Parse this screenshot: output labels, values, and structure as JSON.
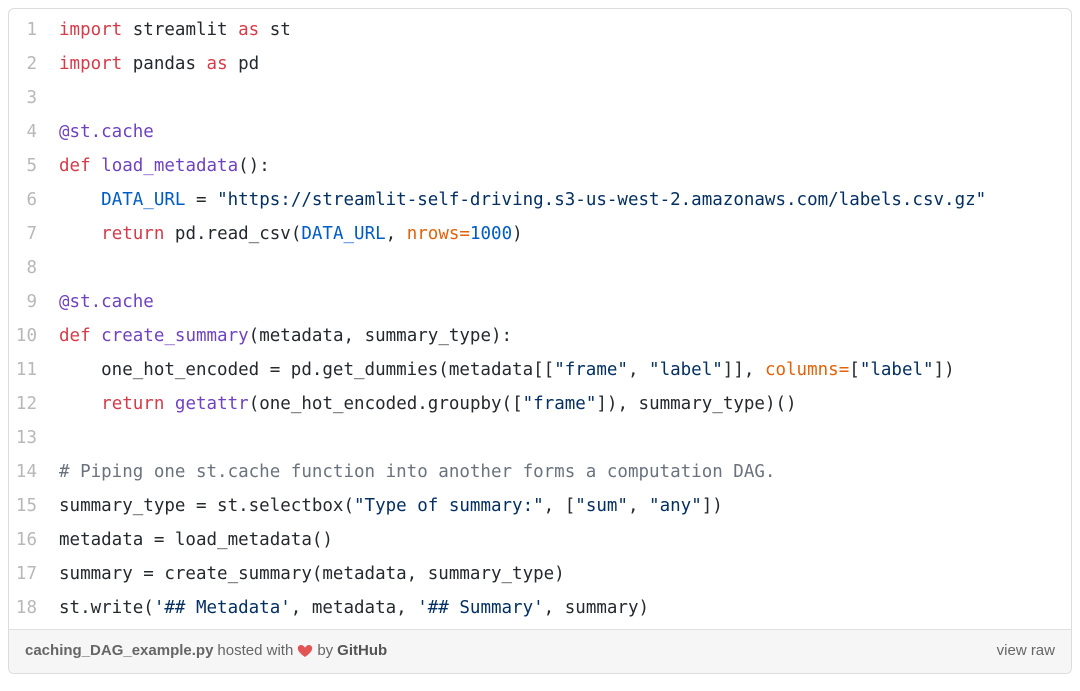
{
  "footer": {
    "filename": "caching_DAG_example.py",
    "hosted_prefix": " hosted with ",
    "by": " by ",
    "github": "GitHub",
    "view_raw": "view raw"
  },
  "lines": [
    {
      "n": "1",
      "tokens": [
        {
          "t": "import ",
          "c": "kw"
        },
        {
          "t": "streamlit ",
          "c": ""
        },
        {
          "t": "as ",
          "c": "kw"
        },
        {
          "t": "st",
          "c": ""
        }
      ]
    },
    {
      "n": "2",
      "tokens": [
        {
          "t": "import ",
          "c": "kw"
        },
        {
          "t": "pandas ",
          "c": ""
        },
        {
          "t": "as ",
          "c": "kw"
        },
        {
          "t": "pd",
          "c": ""
        }
      ]
    },
    {
      "n": "3",
      "tokens": [
        {
          "t": "",
          "c": ""
        }
      ]
    },
    {
      "n": "4",
      "tokens": [
        {
          "t": "@st.cache",
          "c": "dec"
        }
      ]
    },
    {
      "n": "5",
      "tokens": [
        {
          "t": "def ",
          "c": "kw"
        },
        {
          "t": "load_metadata",
          "c": "fn"
        },
        {
          "t": "():",
          "c": ""
        }
      ]
    },
    {
      "n": "6",
      "tokens": [
        {
          "t": "    ",
          "c": ""
        },
        {
          "t": "DATA_URL",
          "c": "const"
        },
        {
          "t": " = ",
          "c": ""
        },
        {
          "t": "\"https://streamlit-self-driving.s3-us-west-2.amazonaws.com/labels.csv.gz\"",
          "c": "str"
        }
      ]
    },
    {
      "n": "7",
      "tokens": [
        {
          "t": "    ",
          "c": ""
        },
        {
          "t": "return ",
          "c": "kw"
        },
        {
          "t": "pd.read_csv(",
          "c": ""
        },
        {
          "t": "DATA_URL",
          "c": "const"
        },
        {
          "t": ", ",
          "c": ""
        },
        {
          "t": "nrows",
          "c": "argn"
        },
        {
          "t": "=",
          "c": "argn"
        },
        {
          "t": "1000",
          "c": "const"
        },
        {
          "t": ")",
          "c": ""
        }
      ]
    },
    {
      "n": "8",
      "tokens": [
        {
          "t": "",
          "c": ""
        }
      ]
    },
    {
      "n": "9",
      "tokens": [
        {
          "t": "@st.cache",
          "c": "dec"
        }
      ]
    },
    {
      "n": "10",
      "tokens": [
        {
          "t": "def ",
          "c": "kw"
        },
        {
          "t": "create_summary",
          "c": "fn"
        },
        {
          "t": "(metadata, summary_type):",
          "c": ""
        }
      ]
    },
    {
      "n": "11",
      "tokens": [
        {
          "t": "    one_hot_encoded = pd.get_dummies(metadata[[",
          "c": ""
        },
        {
          "t": "\"frame\"",
          "c": "str"
        },
        {
          "t": ", ",
          "c": ""
        },
        {
          "t": "\"label\"",
          "c": "str"
        },
        {
          "t": "]], ",
          "c": ""
        },
        {
          "t": "columns",
          "c": "argn"
        },
        {
          "t": "=",
          "c": "argn"
        },
        {
          "t": "[",
          "c": ""
        },
        {
          "t": "\"label\"",
          "c": "str"
        },
        {
          "t": "])",
          "c": ""
        }
      ]
    },
    {
      "n": "12",
      "tokens": [
        {
          "t": "    ",
          "c": ""
        },
        {
          "t": "return ",
          "c": "kw"
        },
        {
          "t": "getattr",
          "c": "fn"
        },
        {
          "t": "(one_hot_encoded.groupby([",
          "c": ""
        },
        {
          "t": "\"frame\"",
          "c": "str"
        },
        {
          "t": "]), summary_type)()",
          "c": ""
        }
      ]
    },
    {
      "n": "13",
      "tokens": [
        {
          "t": "",
          "c": ""
        }
      ]
    },
    {
      "n": "14",
      "tokens": [
        {
          "t": "# Piping one st.cache function into another forms a computation DAG.",
          "c": "cmt"
        }
      ]
    },
    {
      "n": "15",
      "tokens": [
        {
          "t": "summary_type = st.selectbox(",
          "c": ""
        },
        {
          "t": "\"Type of summary:\"",
          "c": "str"
        },
        {
          "t": ", [",
          "c": ""
        },
        {
          "t": "\"sum\"",
          "c": "str"
        },
        {
          "t": ", ",
          "c": ""
        },
        {
          "t": "\"any\"",
          "c": "str"
        },
        {
          "t": "])",
          "c": ""
        }
      ]
    },
    {
      "n": "16",
      "tokens": [
        {
          "t": "metadata = load_metadata()",
          "c": ""
        }
      ]
    },
    {
      "n": "17",
      "tokens": [
        {
          "t": "summary = create_summary(metadata, summary_type)",
          "c": ""
        }
      ]
    },
    {
      "n": "18",
      "tokens": [
        {
          "t": "st.write(",
          "c": ""
        },
        {
          "t": "'## Metadata'",
          "c": "str"
        },
        {
          "t": ", metadata, ",
          "c": ""
        },
        {
          "t": "'## Summary'",
          "c": "str"
        },
        {
          "t": ", summary)",
          "c": ""
        }
      ]
    }
  ]
}
